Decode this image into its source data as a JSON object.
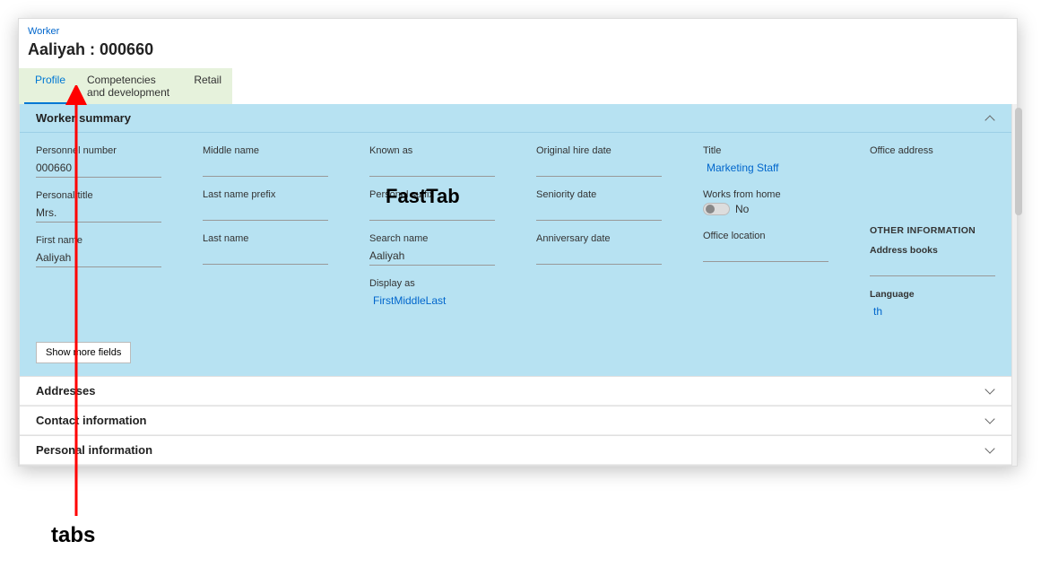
{
  "breadcrumb": "Worker",
  "page_title": "Aaliyah : 000660",
  "tabs": [
    {
      "label": "Profile",
      "active": true
    },
    {
      "label": "Competencies and development",
      "active": false
    },
    {
      "label": "Retail",
      "active": false
    }
  ],
  "worker_summary": {
    "title": "Worker summary",
    "col1": {
      "personnel_number_label": "Personnel number",
      "personnel_number_value": "000660",
      "personal_title_label": "Personal title",
      "personal_title_value": "Mrs.",
      "first_name_label": "First name",
      "first_name_value": "Aaliyah"
    },
    "col2": {
      "middle_name_label": "Middle name",
      "middle_name_value": "",
      "last_name_prefix_label": "Last name prefix",
      "last_name_prefix_value": "",
      "last_name_label": "Last name",
      "last_name_value": ""
    },
    "col3": {
      "known_as_label": "Known as",
      "known_as_value": "",
      "personal_suffix_label": "Personal suffix",
      "personal_suffix_value": "",
      "search_name_label": "Search name",
      "search_name_value": "Aaliyah",
      "display_as_label": "Display as",
      "display_as_value": "FirstMiddleLast"
    },
    "col4": {
      "orig_hire_label": "Original hire date",
      "orig_hire_value": "",
      "seniority_label": "Seniority date",
      "seniority_value": "",
      "anniversary_label": "Anniversary date",
      "anniversary_value": ""
    },
    "col5": {
      "title_label": "Title",
      "title_value": "Marketing Staff",
      "wfh_label": "Works from home",
      "wfh_value": "No",
      "office_loc_label": "Office location",
      "office_loc_value": ""
    },
    "col6": {
      "office_addr_label": "Office address",
      "office_addr_value": "",
      "other_info_heading": "OTHER INFORMATION",
      "addr_books_label": "Address books",
      "addr_books_value": "",
      "language_label": "Language",
      "language_value": "th"
    },
    "show_more": "Show more fields"
  },
  "collapsed_sections": [
    "Addresses",
    "Contact information",
    "Personal information"
  ],
  "annotations": {
    "fasttab": "FastTab",
    "tabs": "tabs"
  }
}
